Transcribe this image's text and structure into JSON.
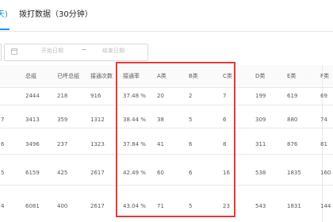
{
  "tabs": {
    "active_label": "天)",
    "second_label": "拨打数据（30分钟）"
  },
  "filter": {
    "start_placeholder": "开始日期",
    "separator": "~",
    "end_placeholder": "结束日期"
  },
  "table": {
    "columns": [
      "总组",
      "已呼总组",
      "接通次数",
      "接通率",
      "A类",
      "B类",
      "C类",
      "D类",
      "E类",
      "F类"
    ],
    "rows": [
      {
        "lead": "",
        "cells": [
          "2444",
          "218",
          "916",
          "37.48 %",
          "20",
          "2",
          "7",
          "199",
          "619",
          "69"
        ]
      },
      {
        "lead": "7",
        "cells": [
          "3413",
          "359",
          "1312",
          "38.44 %",
          "38",
          "5",
          "6",
          "309",
          "880",
          "74"
        ]
      },
      {
        "lead": "6",
        "cells": [
          "3496",
          "237",
          "1323",
          "37.84 %",
          "41",
          "6",
          "8",
          "311",
          "876",
          "81"
        ]
      },
      {
        "lead": "5",
        "cells": [
          "6159",
          "425",
          "2617",
          "42.49 %",
          "60",
          "6",
          "16",
          "538",
          "1835",
          "160"
        ]
      },
      {
        "lead": "4",
        "cells": [
          "6081",
          "400",
          "2617",
          "43.04 %",
          "71",
          "5",
          "23",
          "543",
          "1831",
          "144"
        ]
      }
    ]
  },
  "colors": {
    "accent": "#1890ff",
    "highlight_border": "#e53935"
  }
}
